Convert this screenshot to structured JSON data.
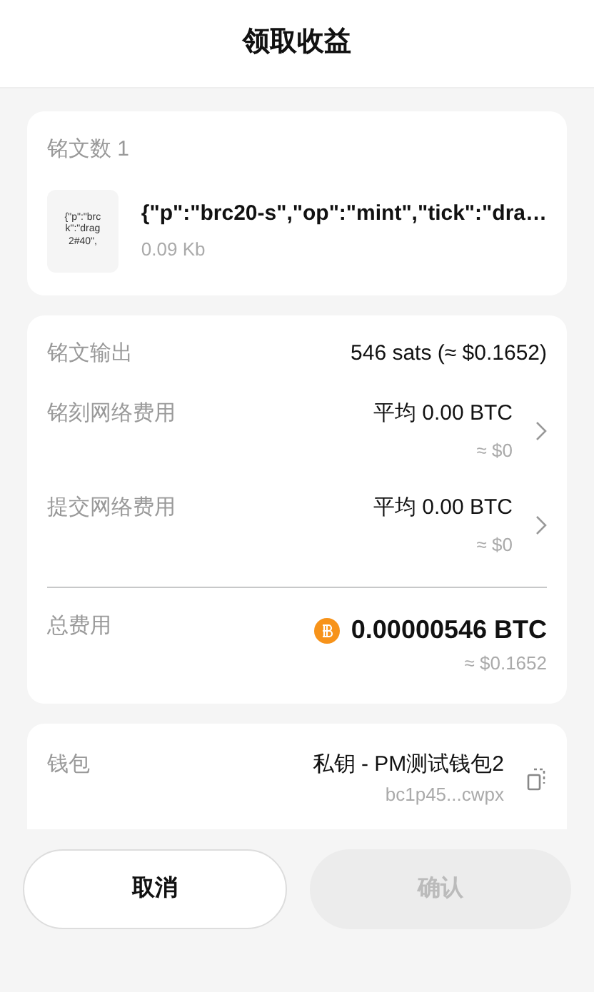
{
  "title": "领取收益",
  "inscriptions": {
    "label": "铭文数 1",
    "items": [
      {
        "thumbnail_lines": [
          "{\"p\":\"brc",
          "k\":\"drag",
          "2#40\","
        ],
        "content": "{\"p\":\"brc20-s\",\"op\":\"mint\",\"tick\":\"dra…",
        "size": "0.09 Kb"
      }
    ]
  },
  "fees": [
    {
      "kind": "plain",
      "label": "铭文输出",
      "value": "546 sats (≈ $0.1652)"
    },
    {
      "kind": "link",
      "label": "铭刻网络费用",
      "value": "平均 0.00 BTC",
      "sub": "≈ $0"
    },
    {
      "kind": "link",
      "label": "提交网络费用",
      "value": "平均 0.00 BTC",
      "sub": "≈ $0"
    }
  ],
  "total": {
    "label": "总费用",
    "value": "0.00000546 BTC",
    "sub": "≈ $0.1652"
  },
  "wallet": {
    "label": "钱包",
    "name": "私钥 - PM测试钱包2",
    "address": "bc1p45...cwpx"
  },
  "buttons": [
    {
      "label": "取消",
      "disabled": false
    },
    {
      "label": "确认",
      "disabled": true
    }
  ]
}
